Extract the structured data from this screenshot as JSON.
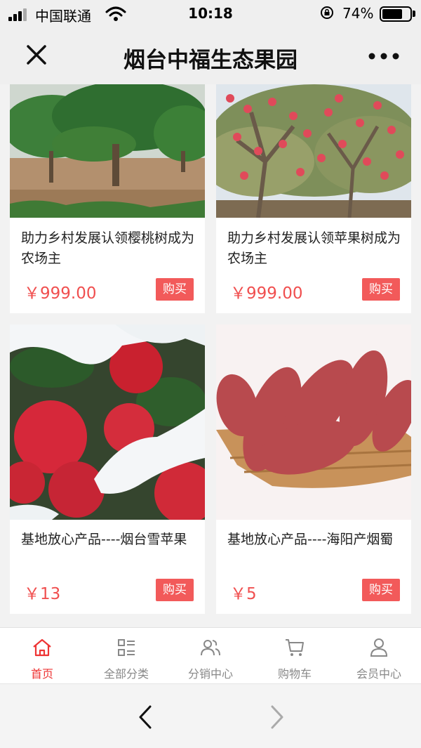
{
  "status_bar": {
    "carrier": "中国联通",
    "time": "10:18",
    "battery_percent": "74%",
    "battery_level": 0.74
  },
  "header": {
    "title": "烟台中福生态果园",
    "close_icon": "close-icon",
    "more_icon": "more-dots-icon"
  },
  "products": [
    {
      "title": "助力乡村发展认领樱桃树成为农场主",
      "price": "￥999.00",
      "buy_label": "购买",
      "image": "cherry-tree-photo"
    },
    {
      "title": "助力乡村发展认领苹果树成为农场主",
      "price": "￥999.00",
      "buy_label": "购买",
      "image": "apple-tree-photo"
    },
    {
      "title": "基地放心产品----烟台雪苹果",
      "price": "￥13",
      "buy_label": "购买",
      "image": "snow-apple-photo"
    },
    {
      "title": "基地放心产品----海阳产烟蜀",
      "price": "￥5",
      "buy_label": "购买",
      "image": "sweet-potato-photo"
    }
  ],
  "tab_bar": {
    "tabs": [
      {
        "label": "首页",
        "icon": "home-icon",
        "active": true
      },
      {
        "label": "全部分类",
        "icon": "category-icon",
        "active": false
      },
      {
        "label": "分销中心",
        "icon": "users-icon",
        "active": false
      },
      {
        "label": "购物车",
        "icon": "cart-icon",
        "active": false
      },
      {
        "label": "会员中心",
        "icon": "user-icon",
        "active": false
      }
    ]
  },
  "browser_bar": {
    "back_icon": "chevron-left-icon",
    "forward_icon": "chevron-right-icon"
  },
  "colors": {
    "accent": "#f25a5a",
    "price": "#f04f4f",
    "active_tab": "#ee3434",
    "inactive_tab": "#888888"
  }
}
